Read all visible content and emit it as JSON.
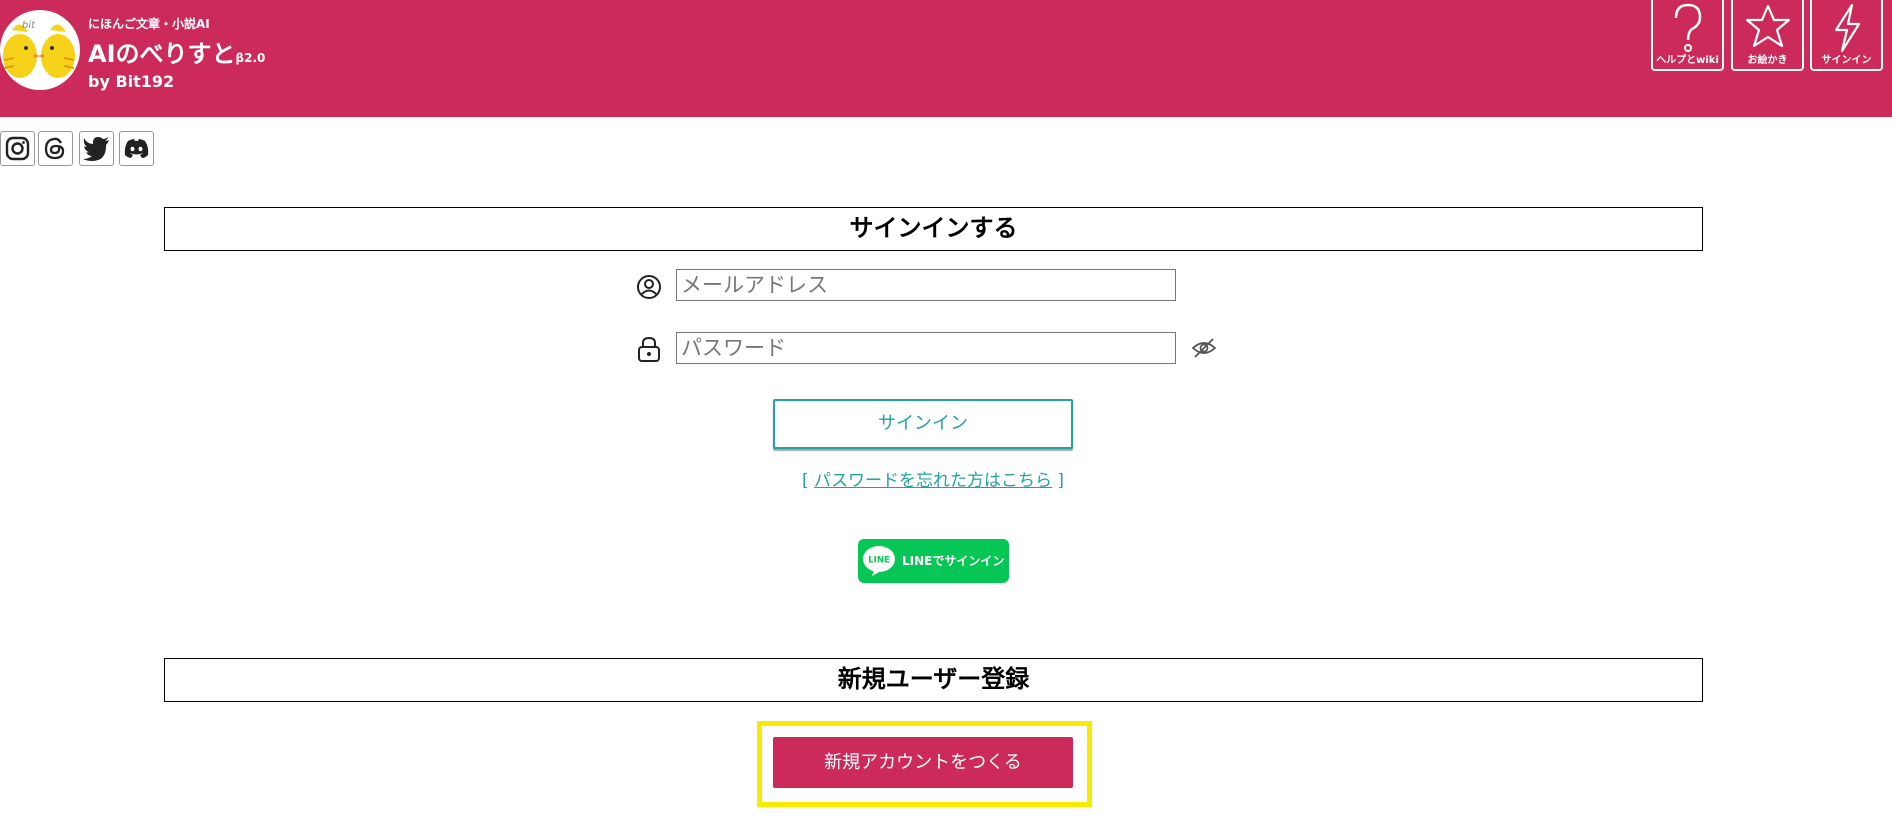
{
  "header": {
    "subtitle": "にほんご文章・小説AI",
    "title": "AIのべりすと",
    "beta": "β2.0",
    "byline": "by Bit192",
    "logo_text": "bit",
    "buttons": [
      {
        "label": "ヘルプとwiki",
        "icon": "question-icon"
      },
      {
        "label": "お絵かき",
        "icon": "star-icon"
      },
      {
        "label": "サインイン",
        "icon": "lightning-icon"
      }
    ]
  },
  "social": [
    "instagram-icon",
    "threads-icon",
    "twitter-icon",
    "discord-icon"
  ],
  "signin": {
    "heading": "サインインする",
    "email_placeholder": "メールアドレス",
    "password_placeholder": "パスワード",
    "button_label": "サインイン",
    "forgot_open": "[",
    "forgot_label": "パスワードを忘れた方はこちら",
    "forgot_close": "]",
    "line_badge": "LINE",
    "line_label": "LINEでサインイン"
  },
  "register": {
    "heading": "新規ユーザー登録",
    "button_label": "新規アカウントをつくる"
  },
  "colors": {
    "brand": "#cc2a5b",
    "accent": "#23a3a0",
    "line_green": "#06c755",
    "highlight": "#f5ec00"
  }
}
